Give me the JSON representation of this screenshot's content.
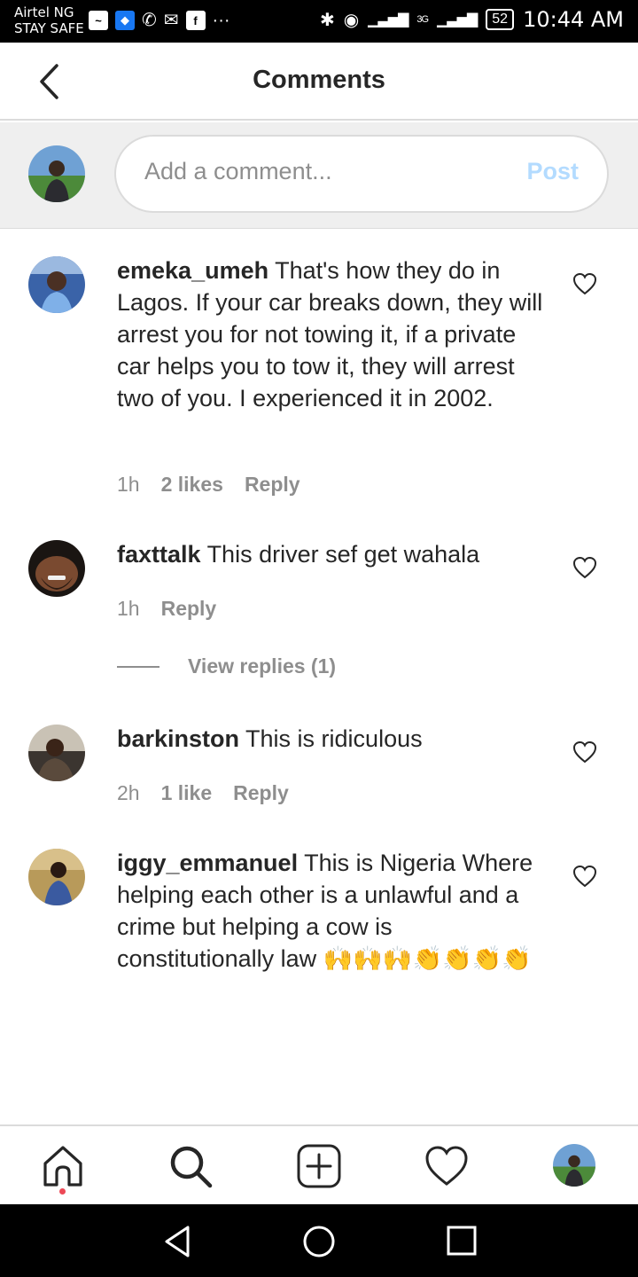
{
  "status_bar": {
    "carrier_line1": "Airtel NG",
    "carrier_line2": "STAY SAFE",
    "network_label": "3G",
    "battery": "52",
    "time": "10:44 AM"
  },
  "header": {
    "title": "Comments"
  },
  "composer": {
    "placeholder": "Add a comment...",
    "post_label": "Post"
  },
  "comments": [
    {
      "username": "emeka_umeh",
      "text": "That's how they do in Lagos. If your car breaks down, they will arrest you for not towing it, if a private car helps you to tow it, they will arrest two of you. I experienced it in 2002.",
      "time": "1h",
      "likes": "2 likes",
      "reply": "Reply"
    },
    {
      "username": "faxttalk",
      "text": "This driver sef get wahala",
      "time": "1h",
      "reply": "Reply",
      "view_replies": "View replies (1)"
    },
    {
      "username": "barkinston",
      "text": "This is ridiculous",
      "time": "2h",
      "likes": "1 like",
      "reply": "Reply"
    },
    {
      "username": "iggy_emmanuel",
      "text": "This is Nigeria Where helping each other is a unlawful and a crime but helping a cow is constitutionally law 🙌🙌🙌👏👏👏👏"
    }
  ],
  "colors": {
    "text": "#262626",
    "secondary": "#8e8e8e",
    "post_disabled": "#b3dbff",
    "divider": "#dbdbdb",
    "notification_dot": "#ed4956"
  }
}
